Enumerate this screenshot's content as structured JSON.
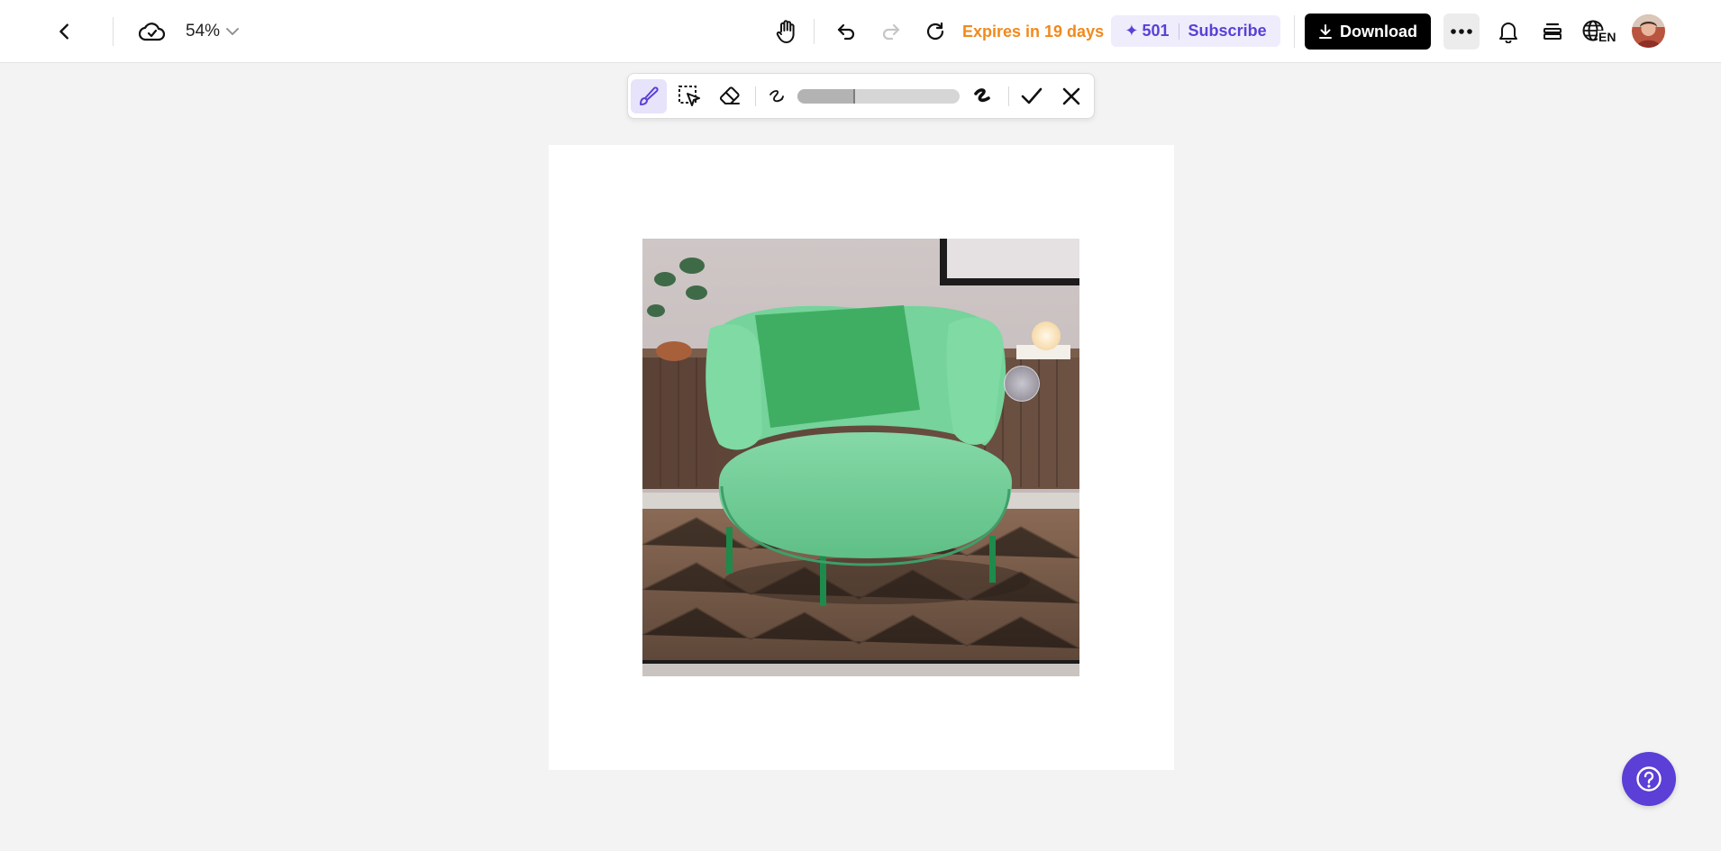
{
  "topbar": {
    "back": {
      "icon": "chevron-left-icon"
    },
    "cloud": {
      "icon": "cloud-check-icon"
    },
    "zoom": {
      "value": "54%",
      "icon": "chevron-down-icon"
    },
    "tools": [
      {
        "name": "hand-icon"
      },
      {
        "name": "undo-icon"
      },
      {
        "name": "redo-icon",
        "enabled": false
      },
      {
        "name": "refresh-icon"
      }
    ],
    "expires": "Expires in 19 days",
    "credits": {
      "star": "✦",
      "count": "501",
      "subscribe": "Subscribe"
    },
    "download": {
      "label": "Download",
      "icon": "download-icon"
    },
    "more": {
      "icon": "more-dots-icon"
    },
    "notifications": {
      "icon": "bell-icon"
    },
    "layers": {
      "icon": "stack-icon"
    },
    "language": {
      "code": "EN",
      "icon": "globe-icon"
    },
    "avatar": {
      "icon": "avatar"
    }
  },
  "edit_toolbar": {
    "tools": [
      {
        "name": "brush-icon",
        "active": true
      },
      {
        "name": "lasso-select-icon",
        "active": false
      },
      {
        "name": "eraser-icon",
        "active": false
      }
    ],
    "brush_size": {
      "min_icon": "thin-stroke-icon",
      "max_icon": "thick-stroke-icon",
      "level": 0.35
    },
    "confirm": {
      "icon": "check-icon"
    },
    "cancel": {
      "icon": "close-icon"
    }
  },
  "canvas": {
    "image": {
      "subject": "green armchair photo"
    }
  },
  "help": {
    "icon": "help-question-icon"
  },
  "colors": {
    "accent": "#5b3fd6",
    "expires": "#f08a1c",
    "download_bg": "#000000",
    "chair": "#6fcf95"
  }
}
